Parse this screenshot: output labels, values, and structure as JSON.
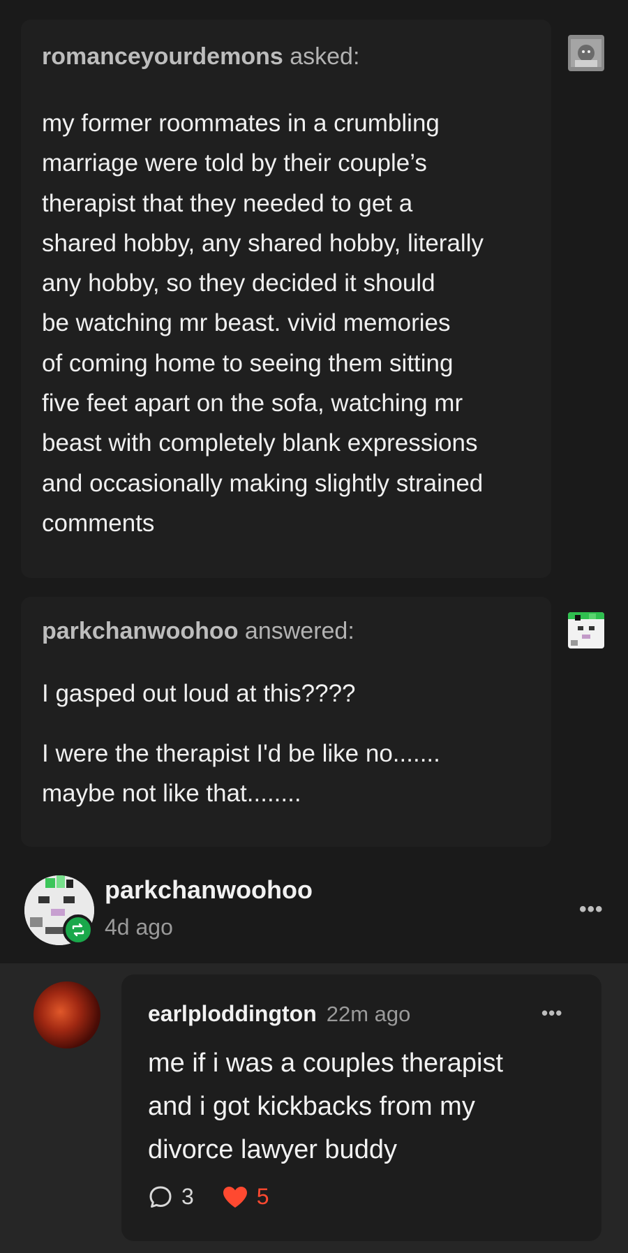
{
  "ask": {
    "asker": "romanceyourdemons",
    "verb": "asked:",
    "lines": [
      "my former roommates in a crumbling",
      "marriage were told by their couple’s",
      "therapist that they needed to get a",
      "shared hobby, any shared hobby, literally",
      "any hobby, so they decided it should",
      "be watching mr beast. vivid memories",
      "of coming home to seeing them sitting",
      "five feet apart on the sofa, watching mr",
      "beast with completely blank expressions",
      "and occasionally making slightly strained",
      "comments"
    ]
  },
  "answer": {
    "answerer": "parkchanwoohoo",
    "verb": "answered:",
    "paragraph1": "I gasped out loud at this????",
    "paragraph2_line1": "I were the therapist I'd be like no.......",
    "paragraph2_line2": "maybe not like that........"
  },
  "reblog": {
    "username": "parkchanwoohoo",
    "time": "4d ago",
    "menu": "•••"
  },
  "comment": {
    "username": "earlploddington",
    "time": "22m ago",
    "menu": "•••",
    "lines": [
      "me if i was a couples therapist",
      "and i got kickbacks from my",
      "divorce lawyer buddy"
    ],
    "replies": "3",
    "likes": "5"
  },
  "colors": {
    "background": "#1a1a1a",
    "card": "#1f1f1f",
    "reblog_green": "#1aa84b",
    "like_red": "#ff4930"
  },
  "icons": [
    "reblog-icon",
    "more-options-icon",
    "comment-bubble-icon",
    "heart-icon"
  ]
}
